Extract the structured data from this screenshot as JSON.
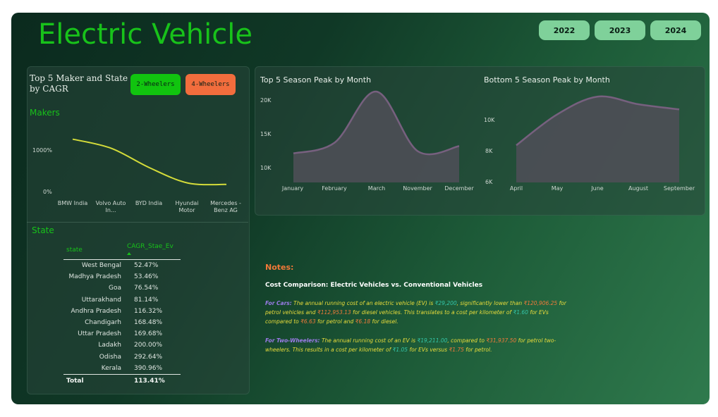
{
  "header": {
    "title": "Electric Vehicle",
    "years": [
      "2022",
      "2023",
      "2024"
    ]
  },
  "left_panel": {
    "title_line1": "Top 5 Maker and State",
    "title_line2": "by CAGR",
    "btn_2w": "2-Wheelers",
    "btn_4w": "4-Wheelers",
    "makers_label": "Makers",
    "state_label": "State"
  },
  "colors": {
    "accent_green": "#18c21a",
    "two_wheelers": "#11c40f",
    "four_wheelers": "#f26d3d",
    "makers_line": "#d4dc3a",
    "area_line": "#d882d2",
    "area_fill": "#7a5a78"
  },
  "chart_data": [
    {
      "type": "line",
      "categories": [
        "BMW India",
        "Volvo Auto In...",
        "BYD India",
        "Hyundai Motor",
        "Mercedes -Benz AG"
      ],
      "values": [
        1175,
        980,
        560,
        230,
        200
      ],
      "ylim": [
        0,
        1700
      ],
      "yticks": [
        "0%",
        "1000%"
      ]
    },
    {
      "type": "area",
      "title": "Top 5 Season Peak by Month",
      "categories": [
        "January",
        "February",
        "March",
        "November",
        "December"
      ],
      "values": [
        13000,
        14500,
        21500,
        13300,
        14000
      ],
      "ylim": [
        9000,
        21500
      ],
      "yticks": [
        "10K",
        "15K",
        "20K"
      ]
    },
    {
      "type": "area",
      "title": "Bottom 5 Season Peak by Month",
      "categories": [
        "April",
        "May",
        "June",
        "August",
        "September"
      ],
      "values": [
        8900,
        11300,
        12700,
        12100,
        11700
      ],
      "ylim": [
        6000,
        13200
      ],
      "yticks": [
        "6K",
        "8K",
        "10K"
      ]
    }
  ],
  "state_table": {
    "headers": [
      "state",
      "CAGR_Stae_Ev"
    ],
    "rows": [
      [
        "West Bengal",
        "52.47%"
      ],
      [
        "Madhya Pradesh",
        "53.46%"
      ],
      [
        "Goa",
        "76.54%"
      ],
      [
        "Uttarakhand",
        "81.14%"
      ],
      [
        "Andhra Pradesh",
        "116.32%"
      ],
      [
        "Chandigarh",
        "168.48%"
      ],
      [
        "Uttar Pradesh",
        "169.68%"
      ],
      [
        "Ladakh",
        "200.00%"
      ],
      [
        "Odisha",
        "292.64%"
      ],
      [
        "Kerala",
        "390.96%"
      ]
    ],
    "total_label": "Total",
    "total_value": "113.41%"
  },
  "notes": {
    "title": "Notes:",
    "subtitle": "Cost Comparison: Electric Vehicles vs. Conventional Vehicles",
    "cars_label": "For Cars:",
    "cars_t1": " The annual running cost of an electric vehicle (EV) is ",
    "cars_ev": "₹29,200",
    "cars_t2": ", significantly lower than ",
    "cars_petrol": "₹120,906.25",
    "cars_t3": " for petrol vehicles and ",
    "cars_diesel": "₹112,953.13",
    "cars_t4": " for diesel vehicles. This translates to a cost per kilometer of ",
    "cars_ev_km": "₹1.60",
    "cars_t5": " for EVs compared to ",
    "cars_petrol_km": "₹6.63",
    "cars_t6": " for petrol and ",
    "cars_diesel_km": "₹6.18",
    "cars_t7": " for diesel.",
    "tw_label": "For Two-Wheelers:",
    "tw_t1": " The annual running cost of an EV is ",
    "tw_ev": "₹19,211.00",
    "tw_t2": ", compared to ",
    "tw_petrol": "₹31,937.50",
    "tw_t3": " for petrol two-wheelers. This results in a cost per kilometer of ",
    "tw_ev_km": "₹1.05",
    "tw_t4": " for EVs versus ",
    "tw_petrol_km": "₹1.75",
    "tw_t5": " for petrol."
  }
}
